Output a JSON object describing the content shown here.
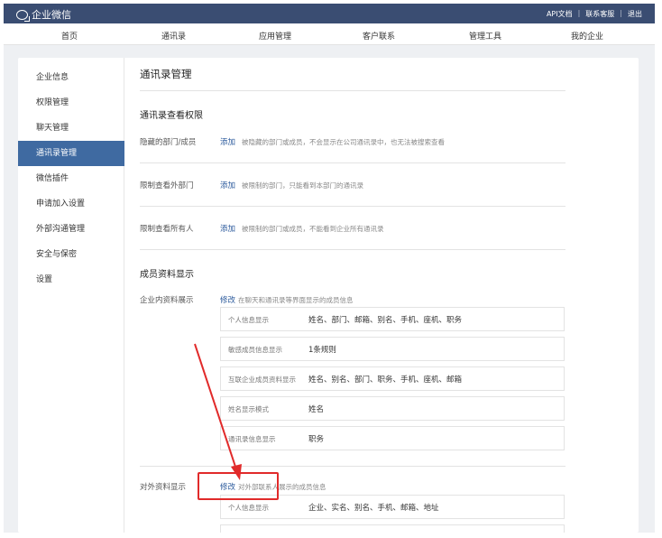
{
  "topbar": {
    "app_name": "企业微信",
    "links": [
      "API文档",
      "联系客服",
      "退出"
    ]
  },
  "nav": {
    "items": [
      "首页",
      "通讯录",
      "应用管理",
      "客户联系",
      "管理工具",
      "我的企业"
    ],
    "active": "我的企业"
  },
  "sidebar": {
    "items": [
      "企业信息",
      "权限管理",
      "聊天管理",
      "通讯录管理",
      "微信插件",
      "申请加入设置",
      "外部沟通管理",
      "安全与保密",
      "设置"
    ],
    "active": "通讯录管理"
  },
  "main": {
    "title": "通讯录管理",
    "view_permissions": {
      "heading": "通讯录查看权限",
      "rows": [
        {
          "label": "隐藏的部门/成员",
          "action": "添加",
          "desc": "被隐藏的部门或成员，不会显示在公司通讯录中，也无法被搜索查看"
        },
        {
          "label": "限制查看外部门",
          "action": "添加",
          "desc": "被限制的部门，只能看到本部门的通讯录"
        },
        {
          "label": "限制查看所有人",
          "action": "添加",
          "desc": "被限制的部门或成员，不能看到企业所有通讯录"
        }
      ]
    },
    "member_display": {
      "heading": "成员资料显示",
      "internal": {
        "label": "企业内资料展示",
        "action": "修改",
        "desc": "在聊天和通讯录等界面显示的成员信息",
        "fields": [
          {
            "key": "个人信息显示",
            "value": "姓名、部门、邮箱、别名、手机、座机、职务"
          },
          {
            "key": "敏感成员信息显示",
            "value": "1条规则"
          },
          {
            "key": "互联企业成员资料显示",
            "value": "姓名、别名、部门、职务、手机、座机、邮箱"
          },
          {
            "key": "姓名显示模式",
            "value": "姓名"
          },
          {
            "key": "通讯录信息显示",
            "value": "职务"
          }
        ]
      },
      "external": {
        "label": "对外资料显示",
        "action": "修改",
        "desc": "对外部联系人展示的成员信息",
        "fields": [
          {
            "key": "个人信息显示",
            "value": "企业、实名、别名、手机、邮箱、地址"
          }
        ]
      }
    }
  },
  "colors": {
    "topbar": "#3a4d72",
    "sidebar_active": "#3f6aa1",
    "link": "#2b5a9c",
    "annotation": "#e12a2a"
  }
}
